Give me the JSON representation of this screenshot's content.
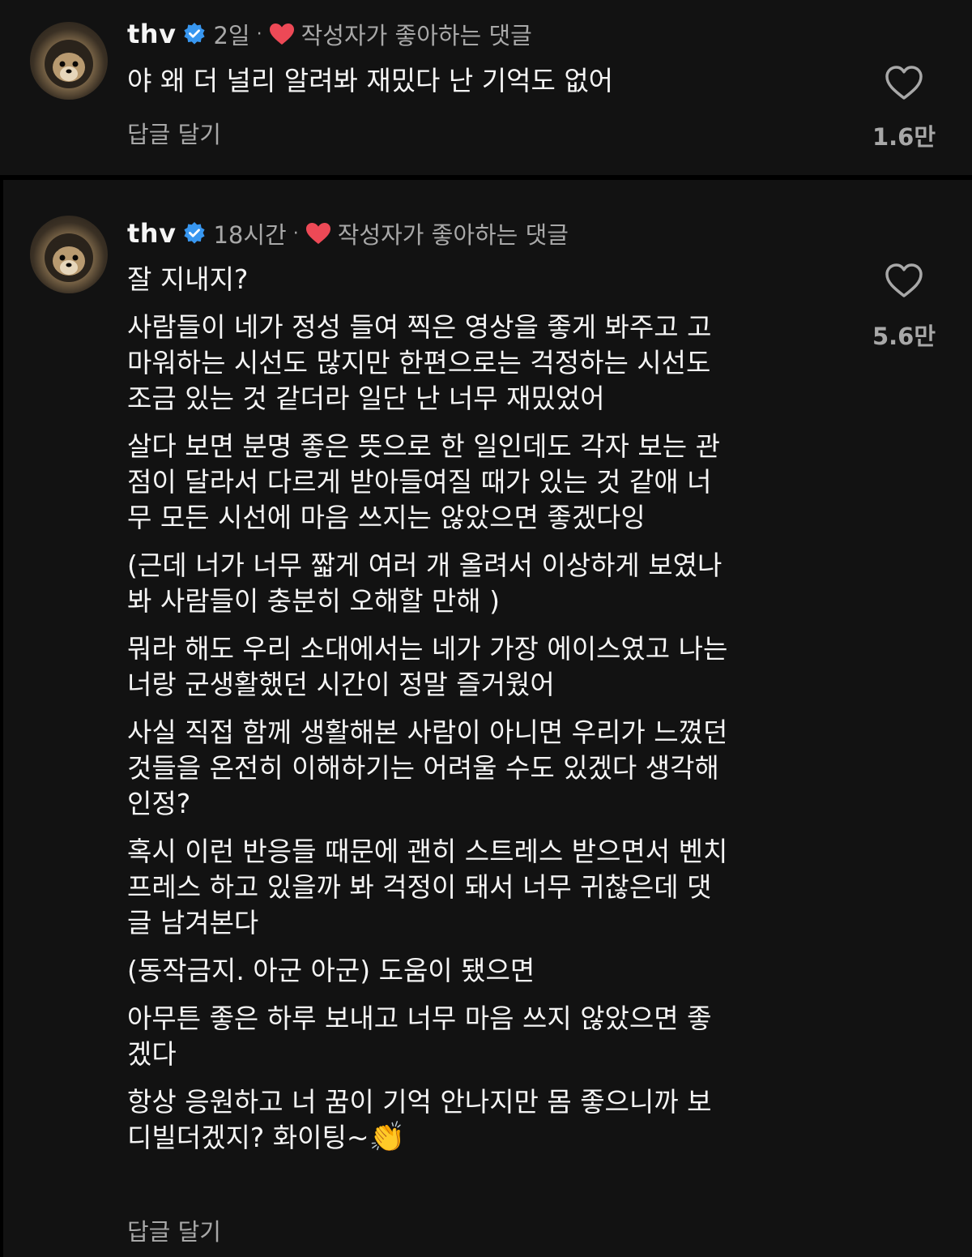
{
  "comments": [
    {
      "username": "thv",
      "time": "2일",
      "separator": "·",
      "liked_by_author_label": "작성자가 좋아하는 댓글",
      "text": "야 왜 더 널리 알려봐 재밌다 난 기억도 없어",
      "reply_label": "답글 달기",
      "like_count": "1.6만",
      "icons": {
        "avatar": "pomeranian-avatar-icon",
        "verified": "verified-badge-icon",
        "author_like": "red-heart-icon",
        "like": "heart-outline-icon"
      }
    },
    {
      "username": "thv",
      "time": "18시간",
      "separator": "·",
      "liked_by_author_label": "작성자가 좋아하는 댓글",
      "paragraphs": [
        "잘 지내지?",
        "사람들이 네가 정성 들여 찍은 영상을 좋게 봐주고 고\n마워하는 시선도 많지만 한편으로는 걱정하는 시선도\n조금 있는 것 같더라 일단 난 너무 재밌었어",
        "살다 보면 분명 좋은 뜻으로 한 일인데도 각자 보는 관\n점이 달라서 다르게 받아들여질 때가 있는 것 같애 너\n무 모든 시선에 마음 쓰지는 않았으면 좋겠다잉",
        "(근데 너가 너무 짧게 여러 개 올려서 이상하게 보였나\n봐 사람들이 충분히 오해할 만해 )",
        "뭐라 해도 우리 소대에서는 네가 가장 에이스였고 나는\n너랑 군생활했던 시간이 정말 즐거웠어",
        "사실 직접 함께 생활해본 사람이 아니면 우리가 느꼈던\n것들을 온전히 이해하기는 어려울 수도 있겠다 생각해\n인정?",
        "혹시 이런 반응들 때문에 괜히 스트레스 받으면서 벤치\n프레스 하고 있을까 봐 걱정이 돼서 너무 귀찮은데 댓\n글 남겨본다",
        "(동작금지. 아군 아군) 도움이 됐으면",
        "아무튼 좋은 하루 보내고 너무 마음 쓰지 않았으면 좋\n겠다",
        "항상 응원하고 너 꿈이 기억 안나지만 몸 좋으니까 보\n디빌더겠지? 화이팅~"
      ],
      "emoji_clap": "👏",
      "reply_label": "답글 달기",
      "like_count": "5.6만",
      "icons": {
        "avatar": "pomeranian-avatar-icon",
        "verified": "verified-badge-icon",
        "author_like": "red-heart-icon",
        "like": "heart-outline-icon",
        "emoji": "clapping-hands-icon"
      }
    }
  ],
  "colors": {
    "background": "#000000",
    "panel": "#121212",
    "text_primary": "#f5f5f5",
    "text_secondary": "#a8a8a8",
    "verified_blue": "#3897f0",
    "heart_red": "#ed4956"
  }
}
